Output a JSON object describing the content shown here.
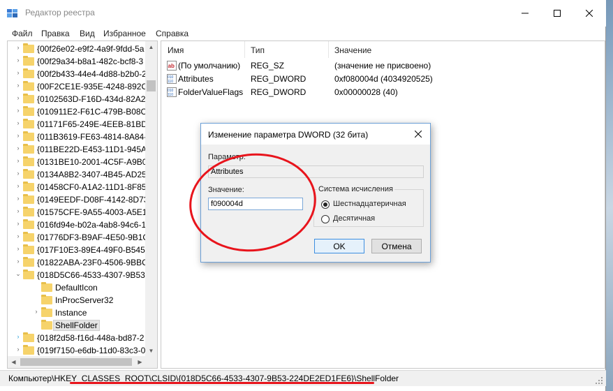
{
  "window": {
    "title": "Редактор реестра",
    "controls": [
      "minimize-icon",
      "maximize-icon",
      "close-icon"
    ]
  },
  "menu": [
    "Файл",
    "Правка",
    "Вид",
    "Избранное",
    "Справка"
  ],
  "tree": {
    "items": [
      {
        "label": "{00f26e02-e9f2-4a9f-9fdd-5a"
      },
      {
        "label": "{00f29a34-b8a1-482c-bcf8-3"
      },
      {
        "label": "{00f2b433-44e4-4d88-b2b0-2"
      },
      {
        "label": "{00F2CE1E-935E-4248-892C-"
      },
      {
        "label": "{0102563D-F16D-434d-82A2-"
      },
      {
        "label": "{010911E2-F61C-479B-B08C-"
      },
      {
        "label": "{01171F65-249E-4EEB-81BD-"
      },
      {
        "label": "{011B3619-FE63-4814-8A84-"
      },
      {
        "label": "{011BE22D-E453-11D1-945A-"
      },
      {
        "label": "{0131BE10-2001-4C5F-A9B0-"
      },
      {
        "label": "{0134A8B2-3407-4B45-AD25"
      },
      {
        "label": "{01458CF0-A1A2-11D1-8F85"
      },
      {
        "label": "{0149EEDF-D08F-4142-8D73-"
      },
      {
        "label": "{01575CFE-9A55-4003-A5E1-"
      },
      {
        "label": "{016fd94e-b02a-4ab8-94c6-1"
      },
      {
        "label": "{01776DF3-B9AF-4E50-9B1C"
      },
      {
        "label": "{017F10E3-89E4-49F0-B545-6"
      },
      {
        "label": "{01822ABA-23F0-4506-9BBC"
      },
      {
        "label": "{018D5C66-4533-4307-9B53-"
      },
      {
        "label": "DefaultIcon"
      },
      {
        "label": "InProcServer32"
      },
      {
        "label": "Instance"
      },
      {
        "label": "ShellFolder"
      },
      {
        "label": "{018f2d58-f16d-448a-bd87-2"
      },
      {
        "label": "{019f7150-e6db-11d0-83c3-0"
      }
    ]
  },
  "values": {
    "columns": [
      "Имя",
      "Тип",
      "Значение"
    ],
    "rows": [
      {
        "name": "(По умолчанию)",
        "type": "REG_SZ",
        "data": "(значение не присвоено)",
        "icon": "string-value-icon"
      },
      {
        "name": "Attributes",
        "type": "REG_DWORD",
        "data": "0xf080004d (4034920525)",
        "icon": "binary-value-icon"
      },
      {
        "name": "FolderValueFlags",
        "type": "REG_DWORD",
        "data": "0x00000028 (40)",
        "icon": "binary-value-icon"
      }
    ]
  },
  "status": {
    "path_prefix": "Компьютер\\",
    "path_highlight": "HKEY_CLASSES_ROOT\\CLSID\\{018D5C66-4533-4307-9B53-224DE2ED1FE6}\\ShellFolder"
  },
  "dialog": {
    "title": "Изменение параметра DWORD (32 бита)",
    "param_label": "Параметр:",
    "param_value": "Attributes",
    "value_label": "Значение:",
    "value_value": "f090004d",
    "radix_legend": "Система исчисления",
    "radix_hex": "Шестнадцатеричная",
    "radix_dec": "Десятичная",
    "radix_selected": "hex",
    "ok": "OK",
    "cancel": "Отмена"
  },
  "colors": {
    "annotation": "#e8141c",
    "folder": "#f6d36b",
    "dialog_border": "#6b9fd6"
  }
}
